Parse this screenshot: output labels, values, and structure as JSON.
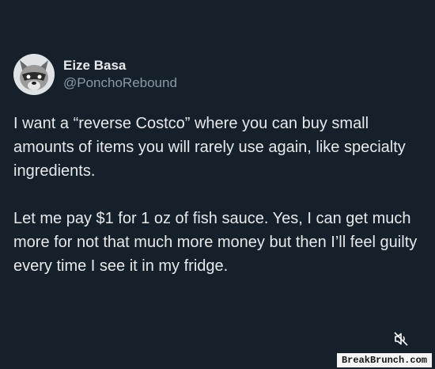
{
  "post": {
    "author_name": "Eize Basa",
    "author_handle": "@PonchoRebound",
    "paragraph_1": "I want a “reverse Costco” where you can buy small amounts of items you will rarely use again, like specialty ingredients.",
    "paragraph_2": "Let me pay $1 for 1 oz of fish sauce. Yes, I can get much more for not that much more money but then I’ll feel guilty every time I see it in my fridge."
  },
  "controls": {
    "mute_icon": "speaker-muted-icon"
  },
  "watermark": {
    "text": "BreakBrunch.com"
  },
  "colors": {
    "background": "#15202b",
    "text": "#e7e9ea",
    "secondary_text": "#8b98a5"
  }
}
